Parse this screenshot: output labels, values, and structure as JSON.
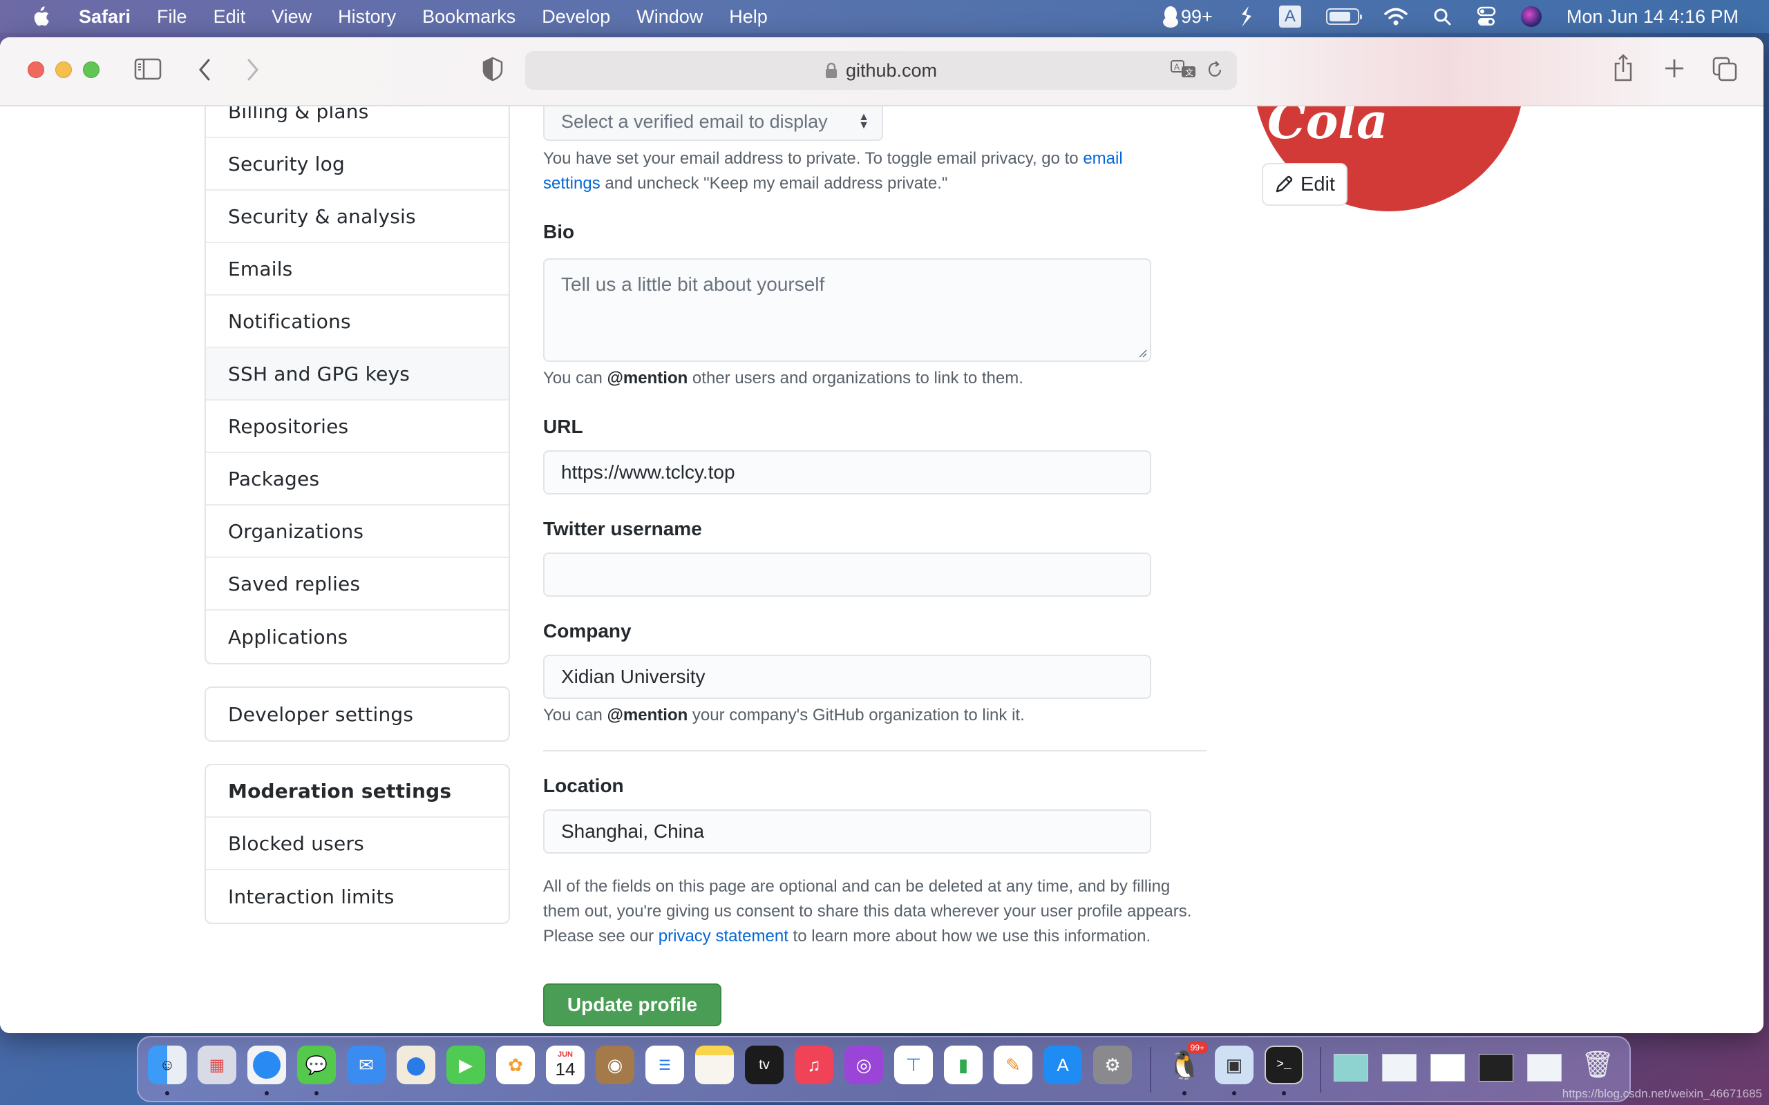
{
  "menubar": {
    "app": "Safari",
    "items": [
      "File",
      "Edit",
      "View",
      "History",
      "Bookmarks",
      "Develop",
      "Window",
      "Help"
    ],
    "status": {
      "qq_count": "99+",
      "input_method": "A",
      "datetime": "Mon Jun 14  4:16 PM",
      "battery_level_percent": 75
    }
  },
  "browser": {
    "url": "github.com"
  },
  "sidebar": {
    "account_items": [
      {
        "label": "Billing & plans",
        "active": false
      },
      {
        "label": "Security log",
        "active": false
      },
      {
        "label": "Security & analysis",
        "active": false
      },
      {
        "label": "Emails",
        "active": false
      },
      {
        "label": "Notifications",
        "active": false
      },
      {
        "label": "SSH and GPG keys",
        "active": true
      },
      {
        "label": "Repositories",
        "active": false
      },
      {
        "label": "Packages",
        "active": false
      },
      {
        "label": "Organizations",
        "active": false
      },
      {
        "label": "Saved replies",
        "active": false
      },
      {
        "label": "Applications",
        "active": false
      }
    ],
    "developer_settings": "Developer settings",
    "moderation": {
      "heading": "Moderation settings",
      "items": [
        "Blocked users",
        "Interaction limits"
      ]
    }
  },
  "form": {
    "email_select": "Select a verified email to display",
    "email_note_prefix": "You have set your email address to private. To toggle email privacy, go to ",
    "email_note_link": "email settings",
    "email_note_suffix": " and uncheck \"Keep my email address private.\"",
    "bio_label": "Bio",
    "bio_placeholder": "Tell us a little bit about yourself",
    "bio_value": "",
    "bio_note_prefix": "You can ",
    "bio_note_bold": "@mention",
    "bio_note_suffix": " other users and organizations to link to them.",
    "url_label": "URL",
    "url_value": "https://www.tclcy.top",
    "twitter_label": "Twitter username",
    "twitter_value": "",
    "company_label": "Company",
    "company_value": "Xidian University",
    "company_note_prefix": "You can ",
    "company_note_bold": "@mention",
    "company_note_suffix": " your company's GitHub organization to link it.",
    "location_label": "Location",
    "location_value": "Shanghai, China",
    "privacy_prefix": "All of the fields on this page are optional and can be deleted at any time, and by filling them out, you're giving us consent to share this data wherever your user profile appears. Please see our ",
    "privacy_link": "privacy statement",
    "privacy_suffix": " to learn more about how we use this information.",
    "update_button": "Update profile"
  },
  "avatar": {
    "edit_label": "Edit",
    "logo_text": "Cola",
    "color": "#d23a38"
  },
  "dock": {
    "apps": [
      "Finder",
      "Launchpad",
      "Safari",
      "Messages",
      "Mail",
      "Maps",
      "FaceTime",
      "Photos",
      "Calendar",
      "Contacts",
      "Reminders",
      "Notes",
      "TV",
      "Music",
      "Podcasts",
      "Keynote",
      "Numbers",
      "Pages",
      "App Store",
      "System Preferences"
    ],
    "calendar_month": "JUN",
    "calendar_day": "14",
    "recent_apps": [
      "QQ",
      "Preview",
      "Terminal"
    ],
    "qq_badge": "99+",
    "minimized_windows": 5,
    "trash": "Trash"
  },
  "watermark": "https://blog.csdn.net/weixin_46671685",
  "colors": {
    "link": "#0366d6",
    "update_button": "#4a9d54",
    "text": "#24292e",
    "muted": "#586069"
  }
}
